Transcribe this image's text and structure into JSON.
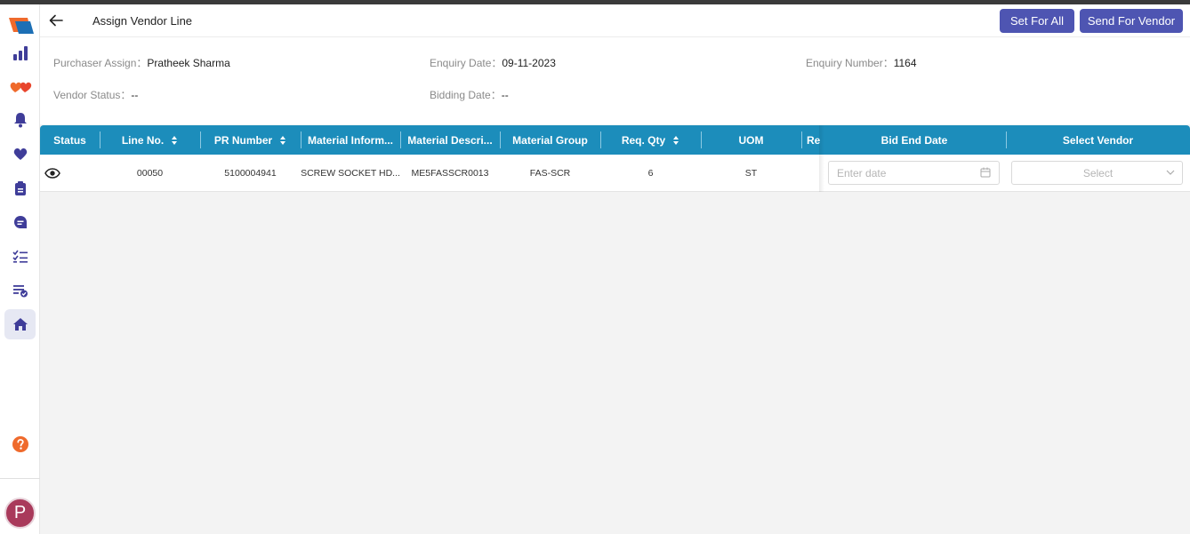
{
  "header": {
    "title": "Assign Vendor Line",
    "set_for_all_label": "Set For All",
    "send_for_vendor_label": "Send For Vendor"
  },
  "info": {
    "purchaser_label": "Purchaser Assign：",
    "purchaser_value": "Pratheek Sharma",
    "enquiry_date_label": "Enquiry Date：",
    "enquiry_date_value": "09-11-2023",
    "enquiry_number_label": "Enquiry Number：",
    "enquiry_number_value": "1164",
    "vendor_status_label": "Vendor Status：",
    "vendor_status_value": "--",
    "bidding_date_label": "Bidding Date：",
    "bidding_date_value": "--"
  },
  "table": {
    "columns": {
      "status": "Status",
      "line_no": "Line No.",
      "pr_number": "PR Number",
      "material_info": "Material Inform...",
      "material_desc": "Material Descri...",
      "material_group": "Material Group",
      "req_qty": "Req. Qty",
      "uom": "UOM",
      "req_partial": "Re",
      "bid_end_date": "Bid End Date",
      "select_vendor": "Select Vendor"
    },
    "rows": [
      {
        "line_no": "00050",
        "pr_number": "5100004941",
        "material_info": "SCREW SOCKET HD...",
        "material_desc": "ME5FASSCR0013",
        "material_group": "FAS-SCR",
        "req_qty": "6",
        "uom": "ST",
        "bid_end_date_placeholder": "Enter date",
        "vendor_placeholder": "Select"
      }
    ]
  },
  "sidebar": {
    "icons": [
      "logo-icon",
      "chart-icon",
      "hearts-icon",
      "bell-icon",
      "heart-icon",
      "document-icon",
      "chat-icon",
      "checklist-icon",
      "list-check-icon",
      "home-icon",
      "help-icon"
    ],
    "avatar_initial": "P"
  },
  "colors": {
    "primary": "#4e55b2",
    "table_header": "#1c8dbb",
    "avatar": "#a93a5b",
    "sidebar_icon": "#3f3d99",
    "accent_orange": "#ef6a2c"
  }
}
